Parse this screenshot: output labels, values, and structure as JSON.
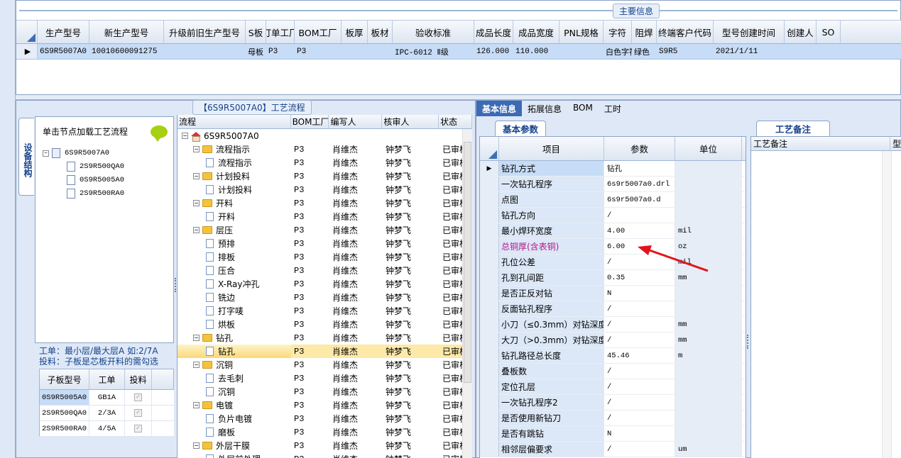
{
  "main_info": {
    "title": "主要信息",
    "columns": [
      "生产型号",
      "新生产型号",
      "升级前旧生产型号",
      "S板",
      "订单工厂",
      "BOM工厂",
      "板厚",
      "板材",
      "验收标准",
      "成品长度",
      "成品宽度",
      "PNL规格",
      "字符",
      "阻焊",
      "终端客户代码",
      "型号创建时间",
      "创建人",
      "SO"
    ],
    "row": [
      "6S9R5007A0",
      "10010600091275",
      "",
      "母板",
      "P3",
      "P3",
      "",
      "",
      "IPC-6012 Ⅱ级",
      "126.000",
      "110.000",
      "",
      "白色字符",
      "绿色",
      "S9R5",
      "2021/1/11",
      "",
      ""
    ]
  },
  "left_panel": {
    "vertical_tab": "设备结构",
    "load_hint": "单击节点加载工艺流程",
    "tree": {
      "root": "6S9R5007A0",
      "children": [
        "2S9R500QA0",
        "0S9R5005A0",
        "2S9R500RA0"
      ]
    },
    "legend_line1": "工单：最小层/最大层A 如:2/7A",
    "legend_line2": "投料：子板是芯板开料的需勾选",
    "sub_grid": {
      "headers": [
        "子板型号",
        "工单",
        "投料"
      ],
      "rows": [
        {
          "model": "0S9R5005A0",
          "order": "GB1A",
          "feed": "✓"
        },
        {
          "model": "2S9R500QA0",
          "order": "2/3A",
          "feed": "✓"
        },
        {
          "model": "2S9R500RA0",
          "order": "4/5A",
          "feed": "✓"
        }
      ]
    }
  },
  "flow": {
    "title": "【6S9R5007A0】工艺流程",
    "headers": [
      "流程",
      "BOM工厂",
      "编写人",
      "核审人",
      "状态"
    ],
    "rows": [
      {
        "level": 0,
        "type": "root",
        "name": "6S9R5007A0",
        "bom": "",
        "writer": "",
        "reviewer": "",
        "status": ""
      },
      {
        "level": 1,
        "type": "folder",
        "name": "流程指示",
        "bom": "P3",
        "writer": "肖维杰",
        "reviewer": "钟梦飞",
        "status": "已审核"
      },
      {
        "level": 2,
        "type": "doc",
        "name": "流程指示",
        "bom": "P3",
        "writer": "肖维杰",
        "reviewer": "钟梦飞",
        "status": "已审核"
      },
      {
        "level": 1,
        "type": "folder",
        "name": "计划投料",
        "bom": "P3",
        "writer": "肖维杰",
        "reviewer": "钟梦飞",
        "status": "已审核"
      },
      {
        "level": 2,
        "type": "doc",
        "name": "计划投料",
        "bom": "P3",
        "writer": "肖维杰",
        "reviewer": "钟梦飞",
        "status": "已审核"
      },
      {
        "level": 1,
        "type": "folder",
        "name": "开料",
        "bom": "P3",
        "writer": "肖维杰",
        "reviewer": "钟梦飞",
        "status": "已审核"
      },
      {
        "level": 2,
        "type": "doc",
        "name": "开料",
        "bom": "P3",
        "writer": "肖维杰",
        "reviewer": "钟梦飞",
        "status": "已审核"
      },
      {
        "level": 1,
        "type": "folder",
        "name": "层压",
        "bom": "P3",
        "writer": "肖维杰",
        "reviewer": "钟梦飞",
        "status": "已审核"
      },
      {
        "level": 2,
        "type": "doc",
        "name": "预排",
        "bom": "P3",
        "writer": "肖维杰",
        "reviewer": "钟梦飞",
        "status": "已审核"
      },
      {
        "level": 2,
        "type": "doc",
        "name": "排板",
        "bom": "P3",
        "writer": "肖维杰",
        "reviewer": "钟梦飞",
        "status": "已审核"
      },
      {
        "level": 2,
        "type": "doc",
        "name": "压合",
        "bom": "P3",
        "writer": "肖维杰",
        "reviewer": "钟梦飞",
        "status": "已审核"
      },
      {
        "level": 2,
        "type": "doc",
        "name": "X-Ray冲孔",
        "bom": "P3",
        "writer": "肖维杰",
        "reviewer": "钟梦飞",
        "status": "已审核"
      },
      {
        "level": 2,
        "type": "doc",
        "name": "铣边",
        "bom": "P3",
        "writer": "肖维杰",
        "reviewer": "钟梦飞",
        "status": "已审核"
      },
      {
        "level": 2,
        "type": "doc",
        "name": "打字唛",
        "bom": "P3",
        "writer": "肖维杰",
        "reviewer": "钟梦飞",
        "status": "已审核"
      },
      {
        "level": 2,
        "type": "doc",
        "name": "烘板",
        "bom": "P3",
        "writer": "肖维杰",
        "reviewer": "钟梦飞",
        "status": "已审核"
      },
      {
        "level": 1,
        "type": "folder",
        "name": "钻孔",
        "bom": "P3",
        "writer": "肖维杰",
        "reviewer": "钟梦飞",
        "status": "已审核"
      },
      {
        "level": 2,
        "type": "doc",
        "name": "钻孔",
        "bom": "P3",
        "writer": "肖维杰",
        "reviewer": "钟梦飞",
        "status": "已审核",
        "selected": true
      },
      {
        "level": 1,
        "type": "folder",
        "name": "沉铜",
        "bom": "P3",
        "writer": "肖维杰",
        "reviewer": "钟梦飞",
        "status": "已审核"
      },
      {
        "level": 2,
        "type": "doc",
        "name": "去毛刺",
        "bom": "P3",
        "writer": "肖维杰",
        "reviewer": "钟梦飞",
        "status": "已审核"
      },
      {
        "level": 2,
        "type": "doc",
        "name": "沉铜",
        "bom": "P3",
        "writer": "肖维杰",
        "reviewer": "钟梦飞",
        "status": "已审核"
      },
      {
        "level": 1,
        "type": "folder",
        "name": "电镀",
        "bom": "P3",
        "writer": "肖维杰",
        "reviewer": "钟梦飞",
        "status": "已审核"
      },
      {
        "level": 2,
        "type": "doc",
        "name": "负片电镀",
        "bom": "P3",
        "writer": "肖维杰",
        "reviewer": "钟梦飞",
        "status": "已审核"
      },
      {
        "level": 2,
        "type": "doc",
        "name": "磨板",
        "bom": "P3",
        "writer": "肖维杰",
        "reviewer": "钟梦飞",
        "status": "已审核"
      },
      {
        "level": 1,
        "type": "folder",
        "name": "外层干膜",
        "bom": "P3",
        "writer": "肖维杰",
        "reviewer": "钟梦飞",
        "status": "已审核"
      },
      {
        "level": 2,
        "type": "doc",
        "name": "外层前处理",
        "bom": "P3",
        "writer": "肖维杰",
        "reviewer": "钟梦飞",
        "status": "已审核"
      }
    ]
  },
  "right_panel": {
    "tabs": [
      "基本信息",
      "拓展信息",
      "BOM",
      "工时"
    ],
    "basic_params_tab": "基本参数",
    "remark_tab": "工艺备注",
    "remark_headers": [
      "工艺备注",
      "型"
    ],
    "param_headers": [
      "项目",
      "参数",
      "单位"
    ],
    "params": [
      {
        "item": "钻孔方式",
        "value": "钻孔",
        "unit": ""
      },
      {
        "item": "一次钻孔程序",
        "value": "6s9r5007a0.drl",
        "unit": ""
      },
      {
        "item": "点图",
        "value": "6s9r5007a0.d",
        "unit": ""
      },
      {
        "item": "钻孔方向",
        "value": "/",
        "unit": ""
      },
      {
        "item": "最小焊环宽度",
        "value": "4.00",
        "unit": "mil"
      },
      {
        "item": "总铜厚(含表铜)",
        "value": "6.00",
        "unit": "oz",
        "highlight": true
      },
      {
        "item": "孔位公差",
        "value": "/",
        "unit": "mil"
      },
      {
        "item": "孔到孔间距",
        "value": "0.35",
        "unit": "mm"
      },
      {
        "item": "是否正反对钻",
        "value": "N",
        "unit": ""
      },
      {
        "item": "反面钻孔程序",
        "value": "/",
        "unit": ""
      },
      {
        "item": "小刀（≤0.3mm）对钻深度",
        "value": "/",
        "unit": "mm"
      },
      {
        "item": "大刀（>0.3mm）对钻深度",
        "value": "/",
        "unit": "mm"
      },
      {
        "item": "钻孔路径总长度",
        "value": "45.46",
        "unit": "m"
      },
      {
        "item": "叠板数",
        "value": "/",
        "unit": ""
      },
      {
        "item": "定位孔层",
        "value": "/",
        "unit": ""
      },
      {
        "item": "一次钻孔程序2",
        "value": "/",
        "unit": ""
      },
      {
        "item": "是否使用新钻刀",
        "value": "/",
        "unit": ""
      },
      {
        "item": "是否有跳钻",
        "value": "N",
        "unit": ""
      },
      {
        "item": "相邻层偏要求",
        "value": "/",
        "unit": "um"
      }
    ],
    "colors": {
      "annotation_arrow": "#e0141a",
      "highlight_text": "#b5168d"
    }
  }
}
